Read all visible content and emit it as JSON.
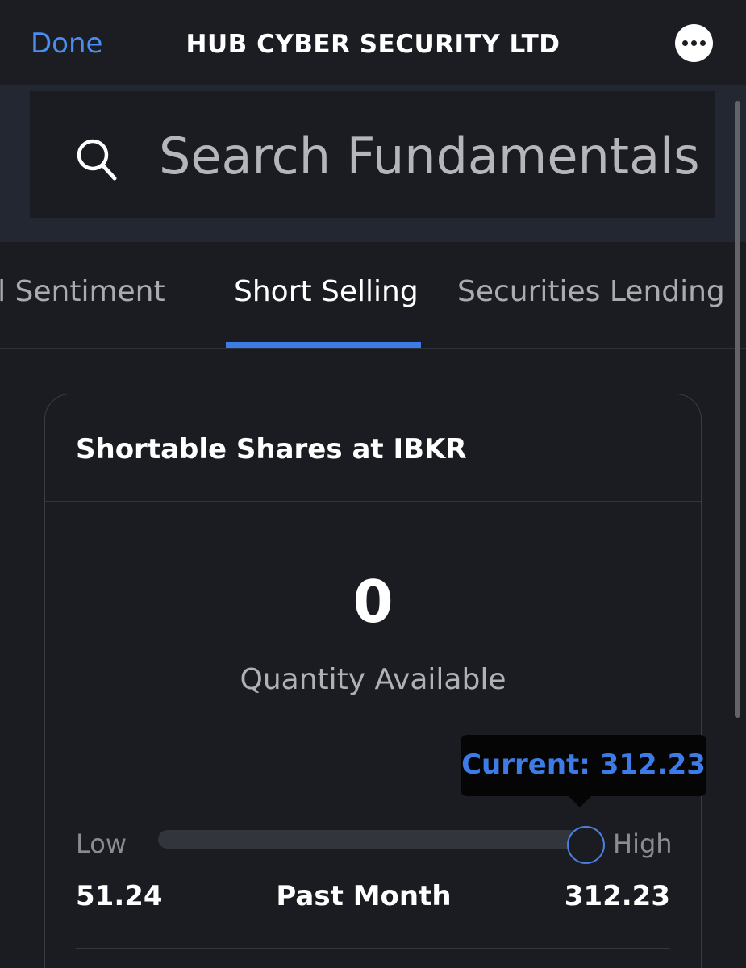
{
  "header": {
    "done_label": "Done",
    "title": "HUB CYBER SECURITY LTD",
    "more_icon": "ellipsis-icon"
  },
  "search": {
    "placeholder": "Search Fundamentals",
    "icon": "search-icon"
  },
  "tabs": [
    {
      "label": "ial Sentiment",
      "active": false
    },
    {
      "label": "Short Selling",
      "active": true
    },
    {
      "label": "Securities Lending",
      "active": false
    }
  ],
  "card": {
    "title": "Shortable Shares at IBKR",
    "value": "0",
    "value_label": "Quantity Available",
    "tooltip": "Current: 312.23",
    "range": {
      "low_label": "Low",
      "high_label": "High",
      "min": "51.24",
      "max": "312.23",
      "period": "Past Month",
      "current_fraction": 1.0
    }
  },
  "colors": {
    "accent": "#3d7be6",
    "background": "#1b1c21",
    "search_band": "#222732"
  }
}
